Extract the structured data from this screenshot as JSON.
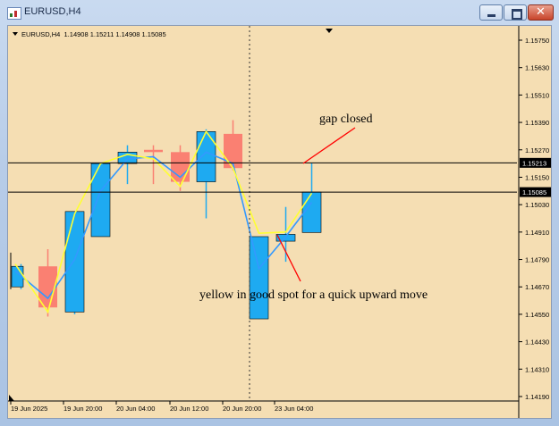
{
  "window": {
    "title": "EURUSD,H4",
    "controls": {
      "close_glyph": "✕"
    }
  },
  "chart_header": {
    "symbol_tf": "EURUSD,H4",
    "ohlc": "1.14908 1.15211 1.14908 1.15085"
  },
  "colors": {
    "background": "#f5deb3",
    "bull_candle": "#1eaaf1",
    "bear_candle": "#fa8072",
    "fast_line": "#ffff33",
    "slow_line": "#3399ff",
    "annotation_line": "#ff0000"
  },
  "price_axis": {
    "labels": [
      "1.15750",
      "1.15630",
      "1.15510",
      "1.15390",
      "1.15270",
      "1.15150",
      "1.15030",
      "1.14910",
      "1.14790",
      "1.14670",
      "1.14550",
      "1.14430",
      "1.14310",
      "1.14190"
    ]
  },
  "time_axis": {
    "labels": [
      "19 Jun 2025",
      "19 Jun 20:00",
      "20 Jun 04:00",
      "20 Jun 12:00",
      "20 Jun 20:00",
      "23 Jun 04:00"
    ]
  },
  "horizontal_lines": [
    {
      "price": 1.15213,
      "label": "1.15213"
    },
    {
      "price": 1.15085,
      "label": "1.15085"
    }
  ],
  "annotations": {
    "gap": "gap closed",
    "yellow": "yellow in good spot for a quick upward move"
  },
  "chart_data": {
    "type": "candlestick",
    "symbol": "EURUSD",
    "timeframe": "H4",
    "ylim": [
      1.1417,
      1.1581
    ],
    "candles": [
      {
        "o": 1.1467,
        "h": 1.1477,
        "l": 1.1466,
        "c": 1.1476,
        "dir": "bull",
        "partial": true
      },
      {
        "o": 1.1476,
        "h": 1.14835,
        "l": 1.1454,
        "c": 1.1458,
        "dir": "bear"
      },
      {
        "o": 1.1456,
        "h": 1.1499,
        "l": 1.1455,
        "c": 1.15,
        "dir": "bull"
      },
      {
        "o": 1.1489,
        "h": 1.1518,
        "l": 1.1489,
        "c": 1.1521,
        "dir": "bull"
      },
      {
        "o": 1.1521,
        "h": 1.1529,
        "l": 1.1512,
        "c": 1.1526,
        "dir": "bull"
      },
      {
        "o": 1.1527,
        "h": 1.1529,
        "l": 1.1512,
        "c": 1.1526,
        "dir": "bear"
      },
      {
        "o": 1.1526,
        "h": 1.1529,
        "l": 1.1509,
        "c": 1.1513,
        "dir": "bear"
      },
      {
        "o": 1.1513,
        "h": 1.1536,
        "l": 1.1497,
        "c": 1.1535,
        "dir": "bull"
      },
      {
        "o": 1.1534,
        "h": 1.154,
        "l": 1.1518,
        "c": 1.1519,
        "dir": "bear"
      },
      {
        "o": 1.1453,
        "h": 1.1489,
        "l": 1.1453,
        "c": 1.1489,
        "dir": "bull"
      },
      {
        "o": 1.1487,
        "h": 1.1502,
        "l": 1.1478,
        "c": 1.149,
        "dir": "bull"
      },
      {
        "o": 1.14908,
        "h": 1.15211,
        "l": 1.14908,
        "c": 1.15085,
        "dir": "bull"
      }
    ],
    "fast_line_values": [
      1.1477,
      1.1456,
      1.1499,
      1.1521,
      1.1525,
      1.1523,
      1.1511,
      1.1535,
      1.1519,
      1.14905,
      1.1491,
      1.1508
    ],
    "slow_line_values": [
      1.1474,
      1.1462,
      1.1479,
      1.1509,
      1.1523,
      1.1524,
      1.1515,
      1.1526,
      1.1521,
      1.1475,
      1.1489,
      1.1504
    ]
  }
}
